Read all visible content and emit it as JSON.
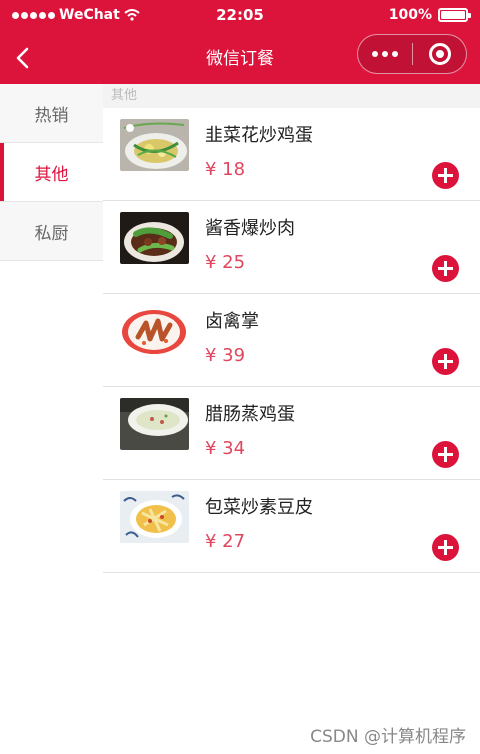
{
  "status_bar": {
    "carrier": "WeChat",
    "time": "22:05",
    "battery": "100%"
  },
  "navbar": {
    "title": "微信订餐",
    "back_icon": "chevron-left-icon",
    "more_icon": "more-dots-icon",
    "close_icon": "target-circle-icon"
  },
  "sidebar": {
    "items": [
      {
        "label": "热销",
        "active": false
      },
      {
        "label": "其他",
        "active": true
      },
      {
        "label": "私厨",
        "active": false
      }
    ]
  },
  "section": {
    "title": "其他"
  },
  "dishes": [
    {
      "name": "韭菜花炒鸡蛋",
      "price": "¥ 18"
    },
    {
      "name": "酱香爆炒肉",
      "price": "¥ 25"
    },
    {
      "name": "卤禽掌",
      "price": "¥ 39"
    },
    {
      "name": "腊肠蒸鸡蛋",
      "price": "¥ 34"
    },
    {
      "name": "包菜炒素豆皮",
      "price": "¥ 27"
    }
  ],
  "watermark": "CSDN @计算机程序",
  "colors": {
    "accent": "#dc143c",
    "price": "#e0475f",
    "sidebar_bg": "#f7f7f7"
  }
}
